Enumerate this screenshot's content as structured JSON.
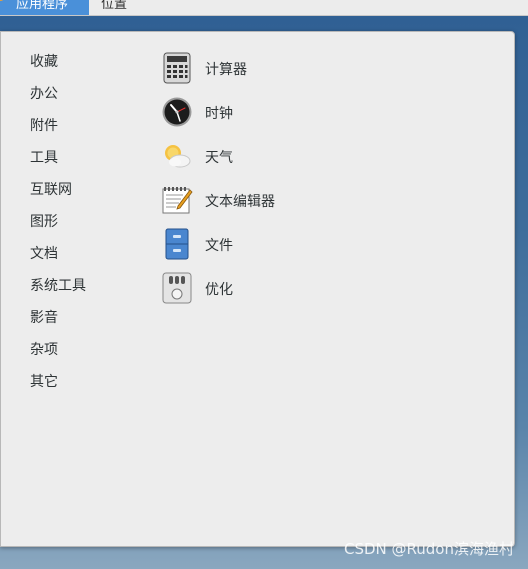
{
  "topbar": {
    "applications_label": "应用程序",
    "places_label": "位置"
  },
  "categories": [
    "收藏",
    "办公",
    "附件",
    "工具",
    "互联网",
    "图形",
    "文档",
    "系统工具",
    "影音",
    "杂项",
    "其它"
  ],
  "apps": [
    {
      "label": "计算器",
      "icon": "calculator-icon"
    },
    {
      "label": "时钟",
      "icon": "clock-icon"
    },
    {
      "label": "天气",
      "icon": "weather-icon"
    },
    {
      "label": "文本编辑器",
      "icon": "text-editor-icon"
    },
    {
      "label": "文件",
      "icon": "files-icon"
    },
    {
      "label": "优化",
      "icon": "tweaks-icon"
    }
  ],
  "watermark": "CSDN @Rudon滨海渔村"
}
